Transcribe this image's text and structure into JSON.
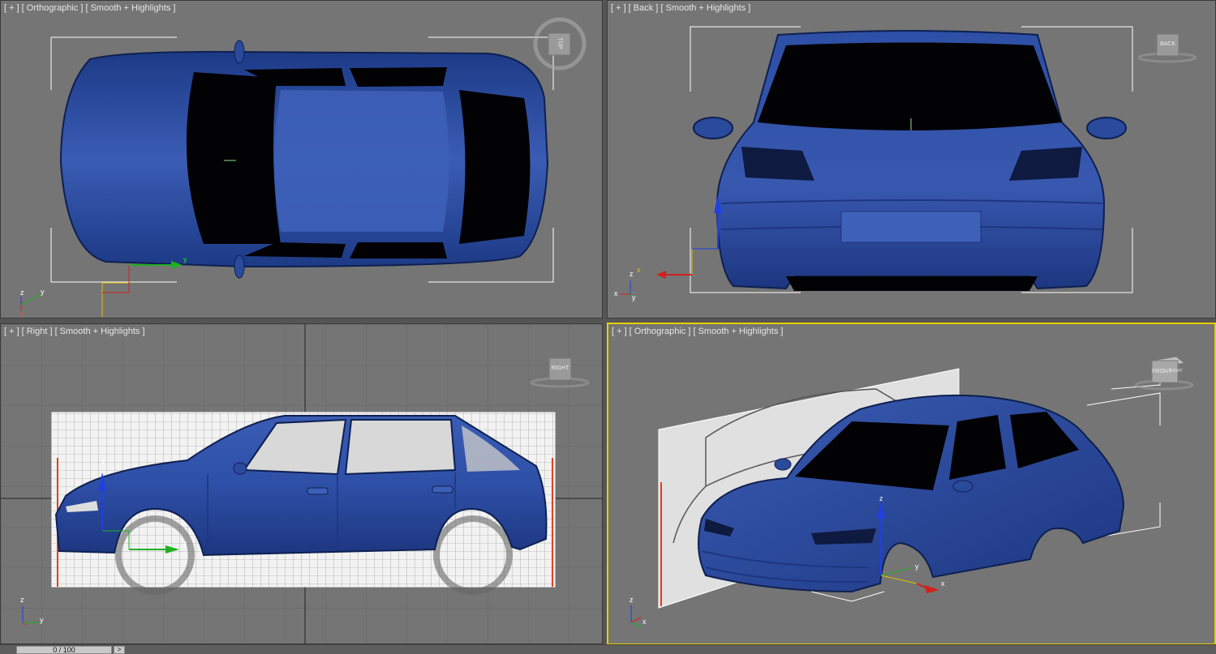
{
  "viewports": {
    "top": {
      "plus": "[ + ]",
      "view": "[ Orthographic ]",
      "shading": "[ Smooth + Highlights ]",
      "cube": "TOP"
    },
    "back": {
      "plus": "[ + ]",
      "view": "[ Back ]",
      "shading": "[ Smooth + Highlights ]",
      "cube": "BACK"
    },
    "right": {
      "plus": "[ + ]",
      "view": "[ Right ]",
      "shading": "[ Smooth + Highlights ]",
      "cube": "RIGHT"
    },
    "persp": {
      "plus": "[ + ]",
      "view": "[ Orthographic ]",
      "shading": "[ Smooth + Highlights ]",
      "cube_front": "FRONT",
      "cube_right": "RIGHT"
    }
  },
  "timebar": {
    "slider": "0 / 100",
    "next": ">"
  },
  "colors": {
    "car_body": "#2a4a9c",
    "viewport_bg": "#757575",
    "active_border": "#e4d000",
    "axis_x": "#d42020",
    "axis_y": "#20b020",
    "axis_z": "#2040e0"
  },
  "icons": {
    "viewcube": "viewcube-icon",
    "axis_tripod": "axis-tripod-icon",
    "gizmo": "move-gizmo-icon"
  }
}
